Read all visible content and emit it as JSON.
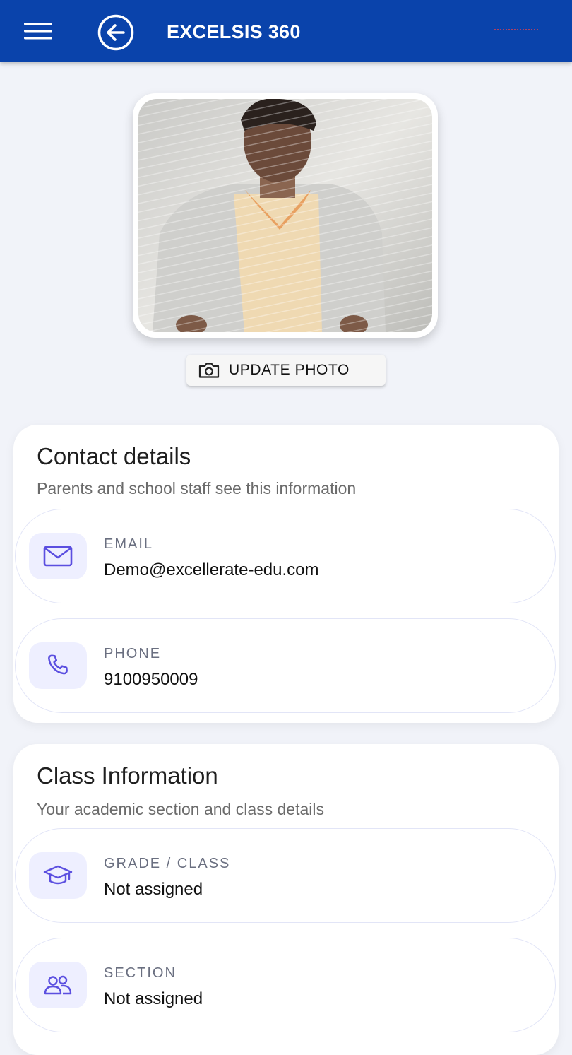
{
  "header": {
    "title": "EXCELSIS 360",
    "menu_icon": "hamburger-menu-icon",
    "back_icon": "arrow-left-circle-icon",
    "background_color": "#0a43ab"
  },
  "profile": {
    "update_photo_label": "UPDATE PHOTO",
    "camera_icon": "camera-icon"
  },
  "contact": {
    "title": "Contact details",
    "subtitle": "Parents and school staff see this information",
    "items": [
      {
        "label": "EMAIL",
        "value": "Demo@excellerate-edu.com",
        "icon": "mail-icon"
      },
      {
        "label": "PHONE",
        "value": "9100950009",
        "icon": "phone-icon"
      }
    ]
  },
  "class_info": {
    "title": "Class Information",
    "subtitle": "Your academic section and class details",
    "items": [
      {
        "label": "GRADE / CLASS",
        "value": "Not assigned",
        "icon": "graduation-cap-icon"
      },
      {
        "label": "SECTION",
        "value": "Not assigned",
        "icon": "users-icon"
      }
    ]
  },
  "colors": {
    "accent_icon": "#5b4fe0",
    "icon_bg": "#eeefff",
    "page_bg": "#f1f3f9"
  }
}
